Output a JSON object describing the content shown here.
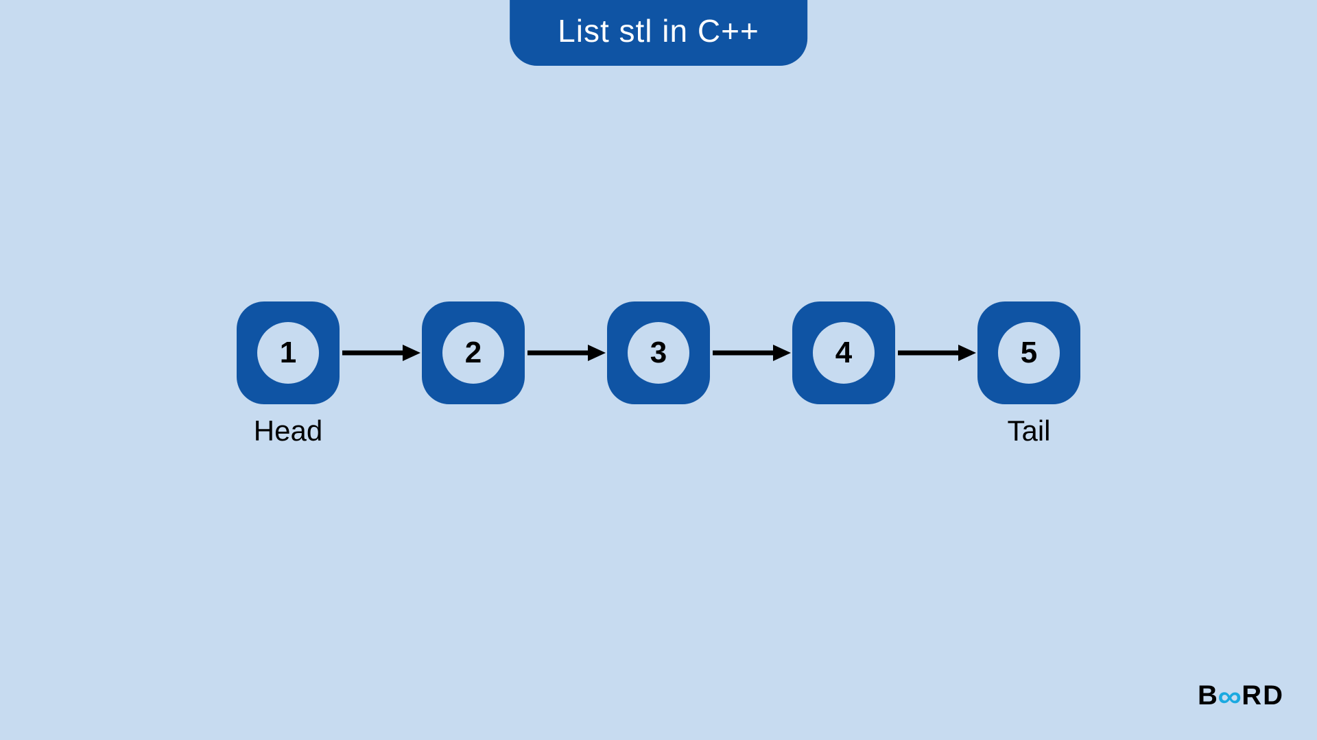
{
  "title": "List stl in C++",
  "nodes": [
    {
      "value": "1",
      "label": "Head"
    },
    {
      "value": "2",
      "label": ""
    },
    {
      "value": "3",
      "label": ""
    },
    {
      "value": "4",
      "label": ""
    },
    {
      "value": "5",
      "label": "Tail"
    }
  ],
  "logo": {
    "left": "B",
    "mid_glyph": "∞",
    "right": "RD"
  }
}
